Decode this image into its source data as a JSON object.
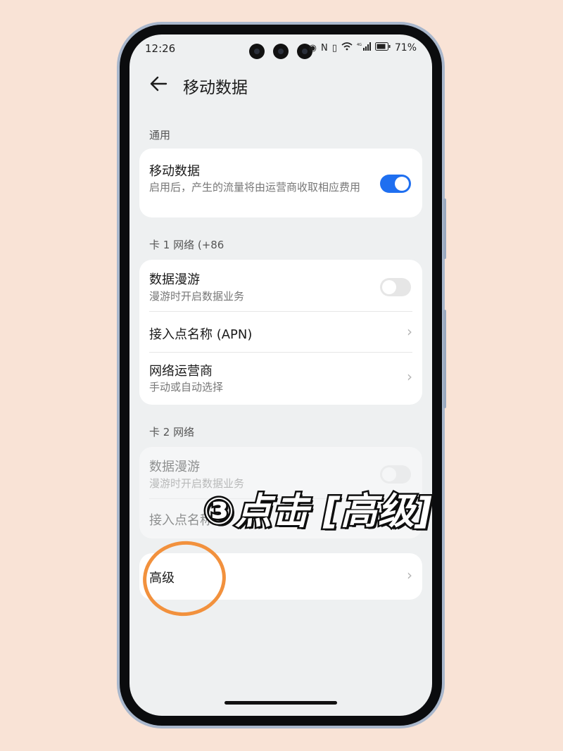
{
  "status_bar": {
    "time": "12:26",
    "signal_badge": "4G",
    "battery": "71%",
    "icons": [
      "eye-icon",
      "nfc-icon",
      "vibrate-icon",
      "wifi-icon",
      "signal-icon",
      "battery-icon"
    ]
  },
  "header": {
    "title": "移动数据",
    "back_icon": "arrow-left-icon"
  },
  "sections": {
    "general": {
      "label": "通用",
      "mobile_data": {
        "title": "移动数据",
        "subtitle": "启用后，产生的流量将由运营商收取相应费用",
        "toggle_on": true
      }
    },
    "sim1": {
      "label": "卡 1 网络 (+86",
      "data_roaming": {
        "title": "数据漫游",
        "subtitle": "漫游时开启数据业务",
        "toggle_on": false
      },
      "apn": {
        "title": "接入点名称 (APN)"
      },
      "carrier": {
        "title": "网络运营商",
        "subtitle": "手动或自动选择"
      }
    },
    "sim2": {
      "label": "卡 2 网络",
      "data_roaming": {
        "title": "数据漫游",
        "subtitle": "漫游时开启数据业务",
        "toggle_on": false
      },
      "apn": {
        "title": "接入点名称"
      }
    },
    "advanced": {
      "title": "高级"
    }
  },
  "overlay": {
    "instruction": "③点击 [高级]",
    "highlight_color": "#f2913d"
  },
  "colors": {
    "accent": "#1f6ff0",
    "background": "#f9e3d6",
    "screen": "#eef0f1"
  }
}
